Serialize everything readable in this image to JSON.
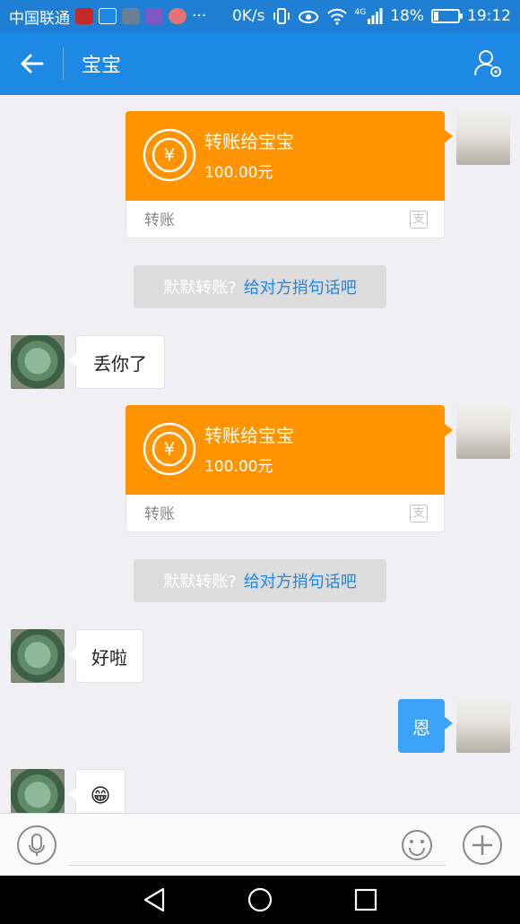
{
  "status": {
    "carrier": "中国联通",
    "more": "···",
    "speed": "0K/s",
    "network": "4G",
    "battery": "18%",
    "battery_level": 0.18,
    "time": "19:12"
  },
  "header": {
    "title": "宝宝"
  },
  "messages": {
    "transfer1": {
      "title": "转账给宝宝",
      "amount": "100.00元",
      "label": "转账"
    },
    "sys1": {
      "text": "默默转账?",
      "link": "给对方捎句话吧"
    },
    "text1": {
      "text": "丢你了"
    },
    "transfer2": {
      "title": "转账给宝宝",
      "amount": "100.00元",
      "label": "转账"
    },
    "sys2": {
      "text": "默默转账?",
      "link": "给对方捎句话吧"
    },
    "text2": {
      "text": "好啦"
    },
    "text3": {
      "text": "恩"
    },
    "text4": {
      "emoji": "😁"
    }
  },
  "icons": {
    "alipay_badge": "支",
    "currency": "¥"
  },
  "colors": {
    "titlebar": "#1e88e5",
    "transfer_orange": "#ff9400",
    "my_bubble": "#3ba2f7",
    "link_blue": "#1e88e5"
  }
}
